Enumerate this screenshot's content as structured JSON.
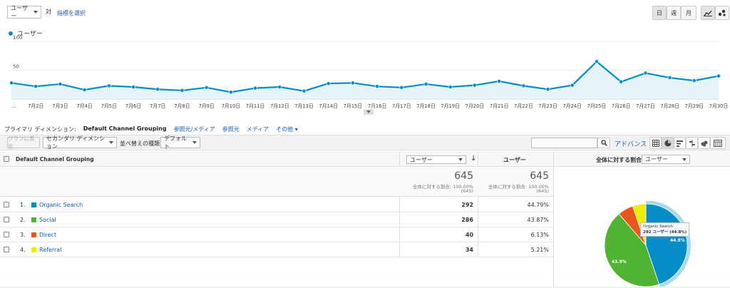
{
  "controls": {
    "metric_selector": "ユーザー",
    "versus": "対",
    "select_metric": "指標を選択",
    "day": "日",
    "week": "週",
    "month": "月"
  },
  "legend": {
    "series_name": "ユーザー",
    "color": "#058dc7"
  },
  "chart_data": {
    "type": "area",
    "series": [
      {
        "name": "ユーザー",
        "values": [
          28,
          22,
          26,
          16,
          23,
          21,
          17,
          15,
          20,
          12,
          19,
          21,
          14,
          27,
          28,
          22,
          20,
          26,
          21,
          24,
          31,
          23,
          17,
          24,
          65,
          30,
          45,
          37,
          32,
          40
        ]
      }
    ],
    "x": [
      "…",
      "7月2日",
      "7月3日",
      "7月4日",
      "7月5日",
      "7月6日",
      "7月7日",
      "7月8日",
      "7月9日",
      "7月10日",
      "7月11日",
      "7月12日",
      "7月13日",
      "7月14日",
      "7月15日",
      "7月16日",
      "7月17日",
      "7月18日",
      "7月19日",
      "7月20日",
      "7月21日",
      "7月22日",
      "7月23日",
      "7月24日",
      "7月25日",
      "7月26日",
      "7月27日",
      "7月28日",
      "7月29日",
      "7月30日"
    ],
    "yticks": [
      "100",
      "50"
    ],
    "ylim": [
      0,
      100
    ],
    "grid": true,
    "color": "#058dc7",
    "fill": "#e6f3fa"
  },
  "dimensions": {
    "label": "プライマリ ディメンション:",
    "active": "Default Channel Grouping",
    "others": [
      "参照元/メディア",
      "参照元",
      "メディア",
      "その他"
    ]
  },
  "toolbar": {
    "plot_rows": "グラフに表示",
    "secondary_dim": "セカンダリ ディメンション",
    "sort_label": "並べ替えの種類:",
    "sort_value": "デフォルト",
    "advanced": "アドバンス",
    "search_placeholder": ""
  },
  "table": {
    "col_dim": "Default Channel Grouping",
    "col_metric_select": "ユーザー",
    "col_metric": "ユーザー",
    "col_share_label": "全体に対する割合:",
    "col_share_select": "ユーザー",
    "total_1": "645",
    "total_1_sub": "全体に対する割合: 100.00%",
    "total_1_sub2": "(645)",
    "total_2": "645",
    "total_2_sub": "全体に対する割合: 100.00%",
    "total_2_sub2": "(645)",
    "rows": [
      {
        "idx": "1.",
        "name": "Organic Search",
        "color": "#058dc7",
        "value": "292",
        "pct": "44.79%"
      },
      {
        "idx": "2.",
        "name": "Social",
        "color": "#50b432",
        "value": "286",
        "pct": "43.87%"
      },
      {
        "idx": "3.",
        "name": "Direct",
        "color": "#ed561b",
        "value": "40",
        "pct": "6.13%"
      },
      {
        "idx": "4.",
        "name": "Referral",
        "color": "#edef00",
        "value": "34",
        "pct": "5.21%"
      }
    ]
  },
  "pie": {
    "slices": [
      {
        "name": "Organic Search",
        "value": 44.8,
        "color": "#058dc7"
      },
      {
        "name": "Social",
        "value": 43.9,
        "color": "#50b432"
      },
      {
        "name": "Direct",
        "value": 6.1,
        "color": "#ed561b"
      },
      {
        "name": "Referral",
        "value": 5.2,
        "color": "#edef00"
      }
    ],
    "label_1": "44.8%",
    "label_2": "43.9%",
    "tooltip_title": "Organic Search",
    "tooltip_value": "292 ユーザー (44.8%)"
  }
}
